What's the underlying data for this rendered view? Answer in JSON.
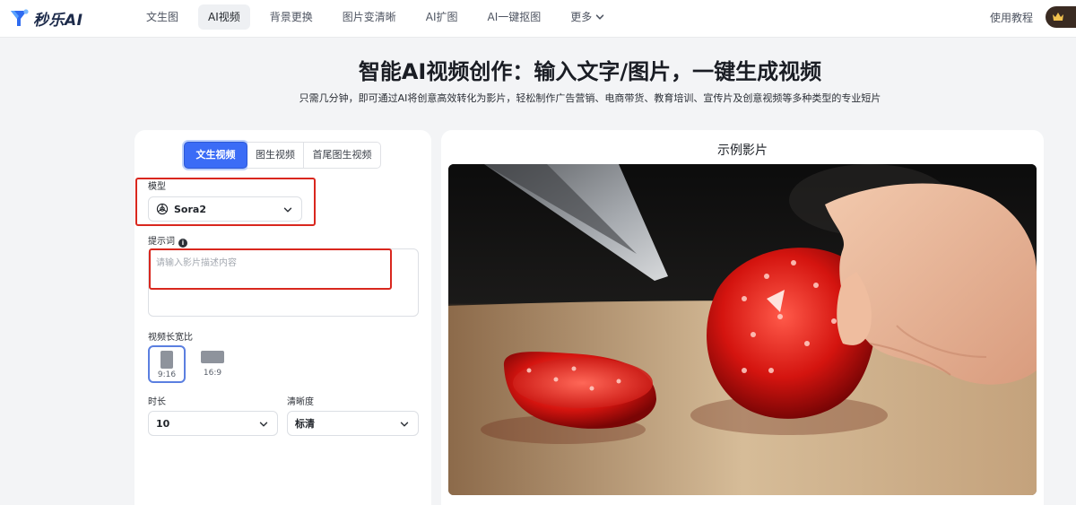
{
  "brand": {
    "name": "秒乐AI"
  },
  "nav": {
    "items": [
      "文生图",
      "AI视频",
      "背景更换",
      "图片变清晰",
      "AI扩图",
      "AI一键抠图"
    ],
    "more_label": "更多",
    "tutorial_label": "使用教程"
  },
  "hero": {
    "title": "智能AI视频创作：输入文字/图片，一键生成视频",
    "subtitle": "只需几分钟，即可通过AI将创意高效转化为影片，轻松制作广告营销、电商带货、教育培训、宣传片及创意视频等多种类型的专业短片"
  },
  "generator": {
    "tabs": [
      "文生视频",
      "图生视频",
      "首尾图生视频"
    ],
    "model_label": "模型",
    "model_value": "Sora2",
    "prompt_label": "提示词",
    "prompt_info_glyph": "i",
    "prompt_placeholder": "请输入影片描述内容",
    "aspect_label": "视频长宽比",
    "aspect_options": [
      "9:16",
      "16:9"
    ],
    "duration_label": "时长",
    "duration_value": "10",
    "quality_label": "清晰度",
    "quality_value": "标清"
  },
  "preview": {
    "title": "示例影片"
  },
  "colors": {
    "accent": "#3b6cf6",
    "highlight_box": "#d9271e",
    "vip_pill": "#3a2b22"
  }
}
